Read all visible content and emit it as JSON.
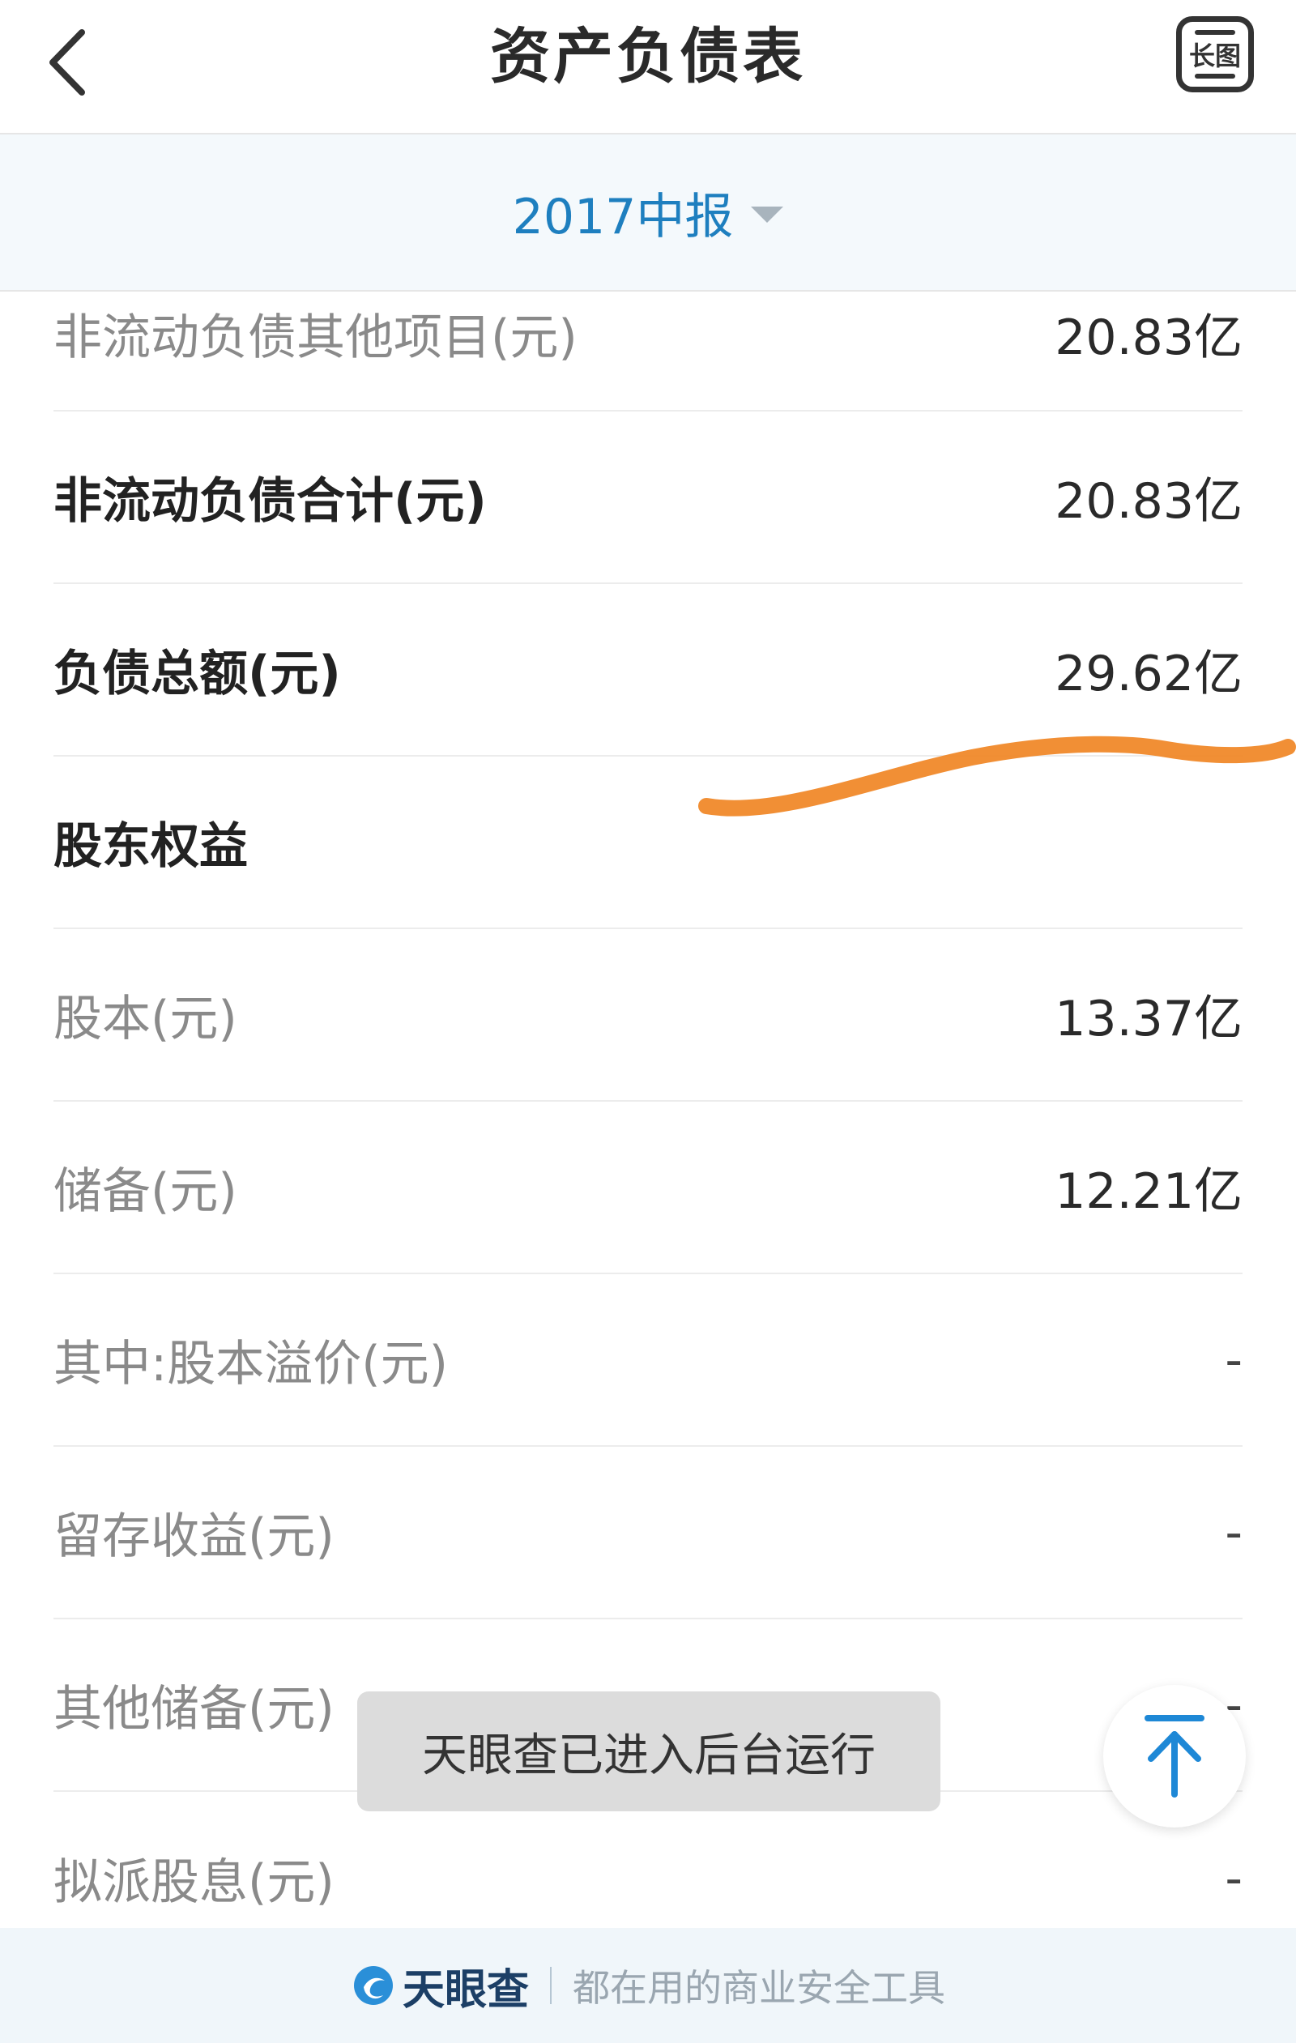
{
  "header": {
    "title": "资产负债表",
    "back_icon": "chevron-left-icon",
    "long_image_label": "长图"
  },
  "period": {
    "selected": "2017中报"
  },
  "rows": [
    {
      "label": "非流动负债其他项目(元)",
      "value": "20.83亿",
      "bold": false
    },
    {
      "label": "非流动负债合计(元)",
      "value": "20.83亿",
      "bold": true
    },
    {
      "label": "负债总额(元)",
      "value": "29.62亿",
      "bold": true
    },
    {
      "label": "股东权益",
      "value": "",
      "bold": true
    },
    {
      "label": "股本(元)",
      "value": "13.37亿",
      "bold": false
    },
    {
      "label": "储备(元)",
      "value": "12.21亿",
      "bold": false
    },
    {
      "label": "其中:股本溢价(元)",
      "value": "-",
      "bold": false
    },
    {
      "label": "留存收益(元)",
      "value": "-",
      "bold": false
    },
    {
      "label": "其他储备(元)",
      "value": "-",
      "bold": false
    },
    {
      "label": "拟派股息(元)",
      "value": "-",
      "bold": false
    }
  ],
  "toast": {
    "message": "天眼查已进入后台运行"
  },
  "footer": {
    "brand": "天眼查",
    "slogan": "都在用的商业安全工具"
  },
  "colors": {
    "accent_blue": "#1e7fbf",
    "annotation_orange": "#f0892a",
    "footer_bg": "#f0f6fa"
  }
}
